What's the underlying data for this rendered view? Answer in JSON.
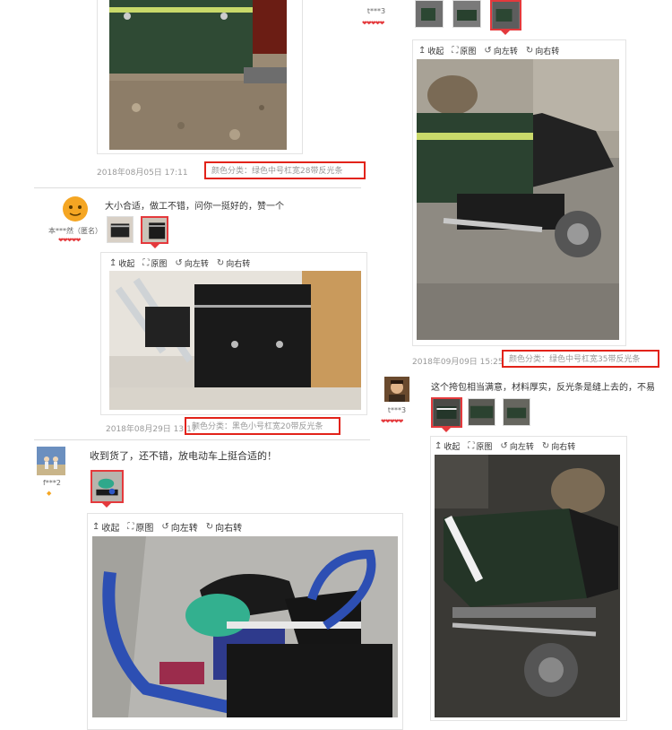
{
  "toolbar": {
    "collapse": "收起",
    "original": "原图",
    "rotate_left": "向左转",
    "rotate_right": "向右转"
  },
  "review1": {
    "date": "2018年08月05日 17:11",
    "sku": "颜色分类：绿色中号杠宽28带反光条"
  },
  "review2": {
    "user": "本***然（匿名）",
    "comment": "大小合适，做工不错，问你一挺好的，赞一个",
    "date": "2018年08月29日 13:17",
    "sku": "颜色分类：黑色小号杠宽20带反光条"
  },
  "review3": {
    "user": "f***2",
    "comment": "收到货了，还不错，放电动车上挺合适的！"
  },
  "review4": {
    "user": "t***3",
    "date": "2018年09月09日 15:25",
    "sku": "颜色分类：绿色中号杠宽35带反光条"
  },
  "review5": {
    "user": "t***3",
    "comment": "这个挎包相当满意，材料厚实，反光条是缝上去的，不易"
  },
  "icons": {
    "collapse": "collapse-icon",
    "original": "expand-icon",
    "rotate_left": "rotate-left-icon",
    "rotate_right": "rotate-right-icon",
    "rating": "heart-icon"
  },
  "colors": {
    "accent": "#e4393c",
    "sku_border": "#e2231a",
    "date": "#999999"
  }
}
